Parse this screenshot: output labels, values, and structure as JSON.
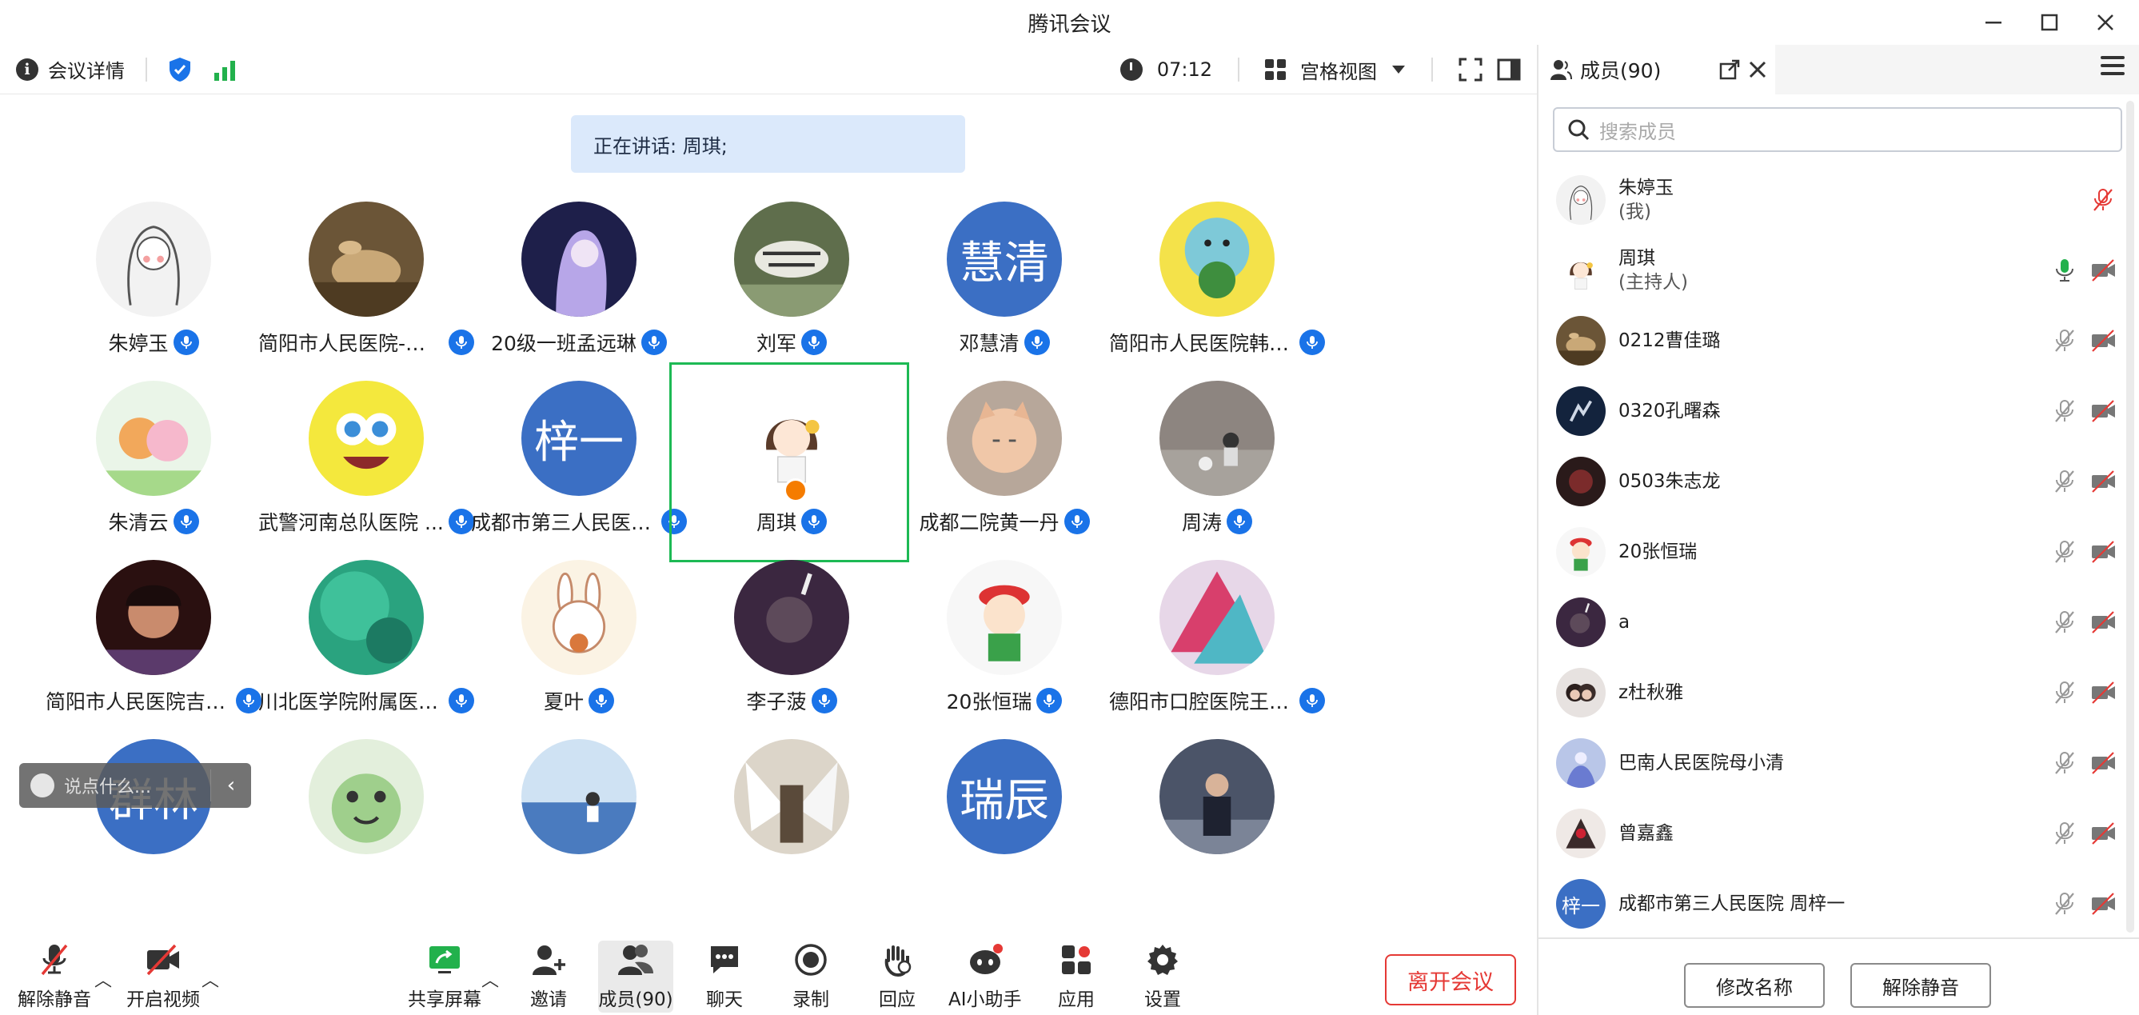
{
  "window": {
    "title": "腾讯会议"
  },
  "topbar": {
    "meeting_info": "会议详情",
    "timer": "07:12",
    "view_mode": "宫格视图"
  },
  "speaking": {
    "text": "正在讲话: 周琪;"
  },
  "grid": [
    {
      "name": "朱婷玉",
      "avatar": "sketch-girl"
    },
    {
      "name": "简阳市人民医院-王...",
      "avatar": "rabbit-photo"
    },
    {
      "name": "20级一班孟远琳",
      "avatar": "anime-girl"
    },
    {
      "name": "刘军",
      "avatar": "tiger-photo"
    },
    {
      "name": "邓慧清",
      "avatar_text": "慧清"
    },
    {
      "name": "简阳市人民医院韩思璇",
      "avatar": "cartoon-broccoli"
    },
    {
      "name": "朱清云",
      "avatar": "bears"
    },
    {
      "name": "武警河南总队医院 ...",
      "avatar": "spongebob"
    },
    {
      "name": "成都市第三人民医院...",
      "avatar_text": "梓一"
    },
    {
      "name": "周琪",
      "avatar": "cartoon-girl",
      "active": true
    },
    {
      "name": "成都二院黄一丹",
      "avatar": "cat-photo"
    },
    {
      "name": "周涛",
      "avatar": "street-photo"
    },
    {
      "name": "简阳市人民医院吉曲...",
      "avatar": "child-photo"
    },
    {
      "name": "川北医学院附属医院...",
      "avatar": "ocean"
    },
    {
      "name": "夏叶",
      "avatar": "bunny"
    },
    {
      "name": "李子菠",
      "avatar": "dark-photo"
    },
    {
      "name": "20张恒瑞",
      "avatar": "crayon-shin"
    },
    {
      "name": "德阳市口腔医院王华杰",
      "avatar": "art-colorful"
    },
    {
      "name": "",
      "avatar_text": "群林"
    },
    {
      "name": "",
      "avatar": "frog"
    },
    {
      "name": "",
      "avatar": "sea-girl"
    },
    {
      "name": "",
      "avatar": "angel-art"
    },
    {
      "name": "",
      "avatar_text": "瑞辰"
    },
    {
      "name": "",
      "avatar": "man-photo"
    }
  ],
  "chat": {
    "placeholder": "说点什么...",
    "arrow": "‹"
  },
  "bottom": {
    "unmute": "解除静音",
    "video": "开启视频",
    "share": "共享屏幕",
    "invite": "邀请",
    "members": "成员(90)",
    "chat": "聊天",
    "record": "录制",
    "react": "回应",
    "ai": "AI小助手",
    "apps": "应用",
    "settings": "设置",
    "leave": "离开会议"
  },
  "panel": {
    "title": "成员(90)",
    "search_placeholder": "搜索成员",
    "members": [
      {
        "name": "朱婷玉",
        "sub": "(我)",
        "avatar": "sketch-girl",
        "mic": "muted-red",
        "video": false
      },
      {
        "name": "周琪",
        "sub": "(主持人)",
        "avatar": "cartoon-girl",
        "mic": "on-green",
        "video": true
      },
      {
        "name": "0212曹佳璐",
        "avatar": "rabbit-photo",
        "mic": "muted",
        "video": true
      },
      {
        "name": "0320孔曙森",
        "avatar": "night-photo",
        "mic": "muted",
        "video": true
      },
      {
        "name": "0503朱志龙",
        "avatar": "dark-red",
        "mic": "muted",
        "video": true
      },
      {
        "name": "20张恒瑞",
        "avatar": "crayon-shin",
        "mic": "muted",
        "video": true
      },
      {
        "name": "a",
        "avatar": "dark-photo",
        "mic": "muted",
        "video": true
      },
      {
        "name": "z杜秋雅",
        "avatar": "girl-photo",
        "mic": "muted",
        "video": true
      },
      {
        "name": "巴南人民医院母小清",
        "avatar": "anime-blue",
        "mic": "muted",
        "video": true
      },
      {
        "name": "曾嘉鑫",
        "avatar": "art-dark",
        "mic": "muted",
        "video": true
      },
      {
        "name": "成都市第三人民医院  周梓一",
        "avatar_text": "梓一",
        "mic": "muted",
        "video": true
      }
    ],
    "rename": "修改名称",
    "unmute_all": "解除静音"
  },
  "colors": {
    "accent": "#1a73e8",
    "active_border": "#1db954",
    "leave": "#e53935",
    "text_avatar": "#3b6fc4"
  }
}
